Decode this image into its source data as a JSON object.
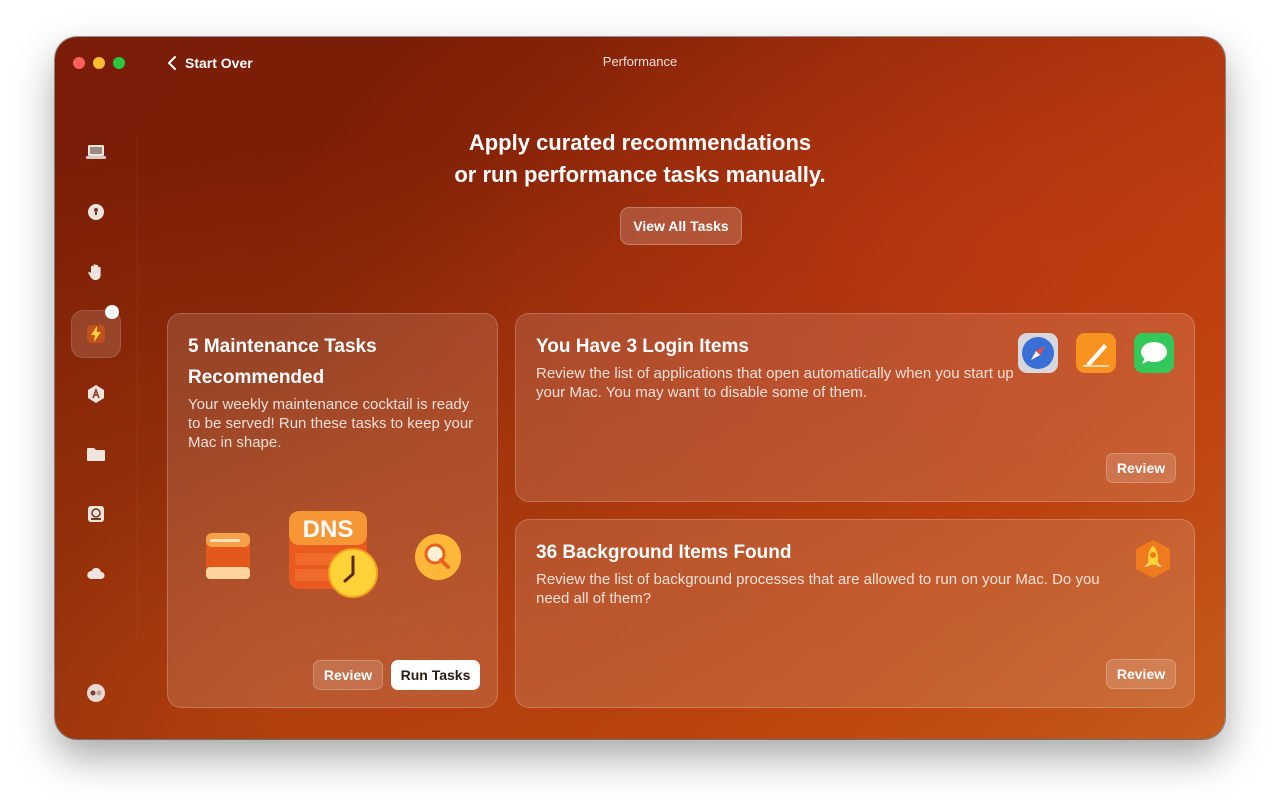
{
  "window": {
    "title": "Performance"
  },
  "nav": {
    "back_label": "Start Over"
  },
  "sidebar": {
    "items": [
      {
        "icon": "macbook-icon"
      },
      {
        "icon": "shield-icon"
      },
      {
        "icon": "hand-icon"
      },
      {
        "icon": "lightning-icon",
        "active": true
      },
      {
        "icon": "app-store-icon"
      },
      {
        "icon": "folder-icon"
      },
      {
        "icon": "disk-icon"
      },
      {
        "icon": "cloud-icon"
      }
    ],
    "bottom_icon": "assistant-icon"
  },
  "hero": {
    "line1": "Apply curated recommendations",
    "line2": "or run performance tasks manually.",
    "view_all_label": "View All Tasks"
  },
  "maintenance_card": {
    "title_line1": "5 Maintenance Tasks",
    "title_line2": "Recommended",
    "description": "Your weekly maintenance cocktail is ready to be served! Run these tasks to keep your Mac in shape.",
    "illustration_text": "DNS",
    "review_label": "Review",
    "run_label": "Run Tasks"
  },
  "login_card": {
    "title": "You Have 3 Login Items",
    "description": "Review the list of applications that open automatically when you start up your Mac. You may want to disable some of them.",
    "apps": [
      "safari-icon",
      "pages-icon",
      "messages-icon"
    ],
    "review_label": "Review"
  },
  "background_card": {
    "title": "36 Background Items Found",
    "description": "Review the list of background processes that are allowed to run on your Mac. Do you need all of them?",
    "icon": "rocket-icon",
    "review_label": "Review"
  },
  "colors": {
    "accent": "#b8420d",
    "window_bg": "#7c1f06"
  }
}
